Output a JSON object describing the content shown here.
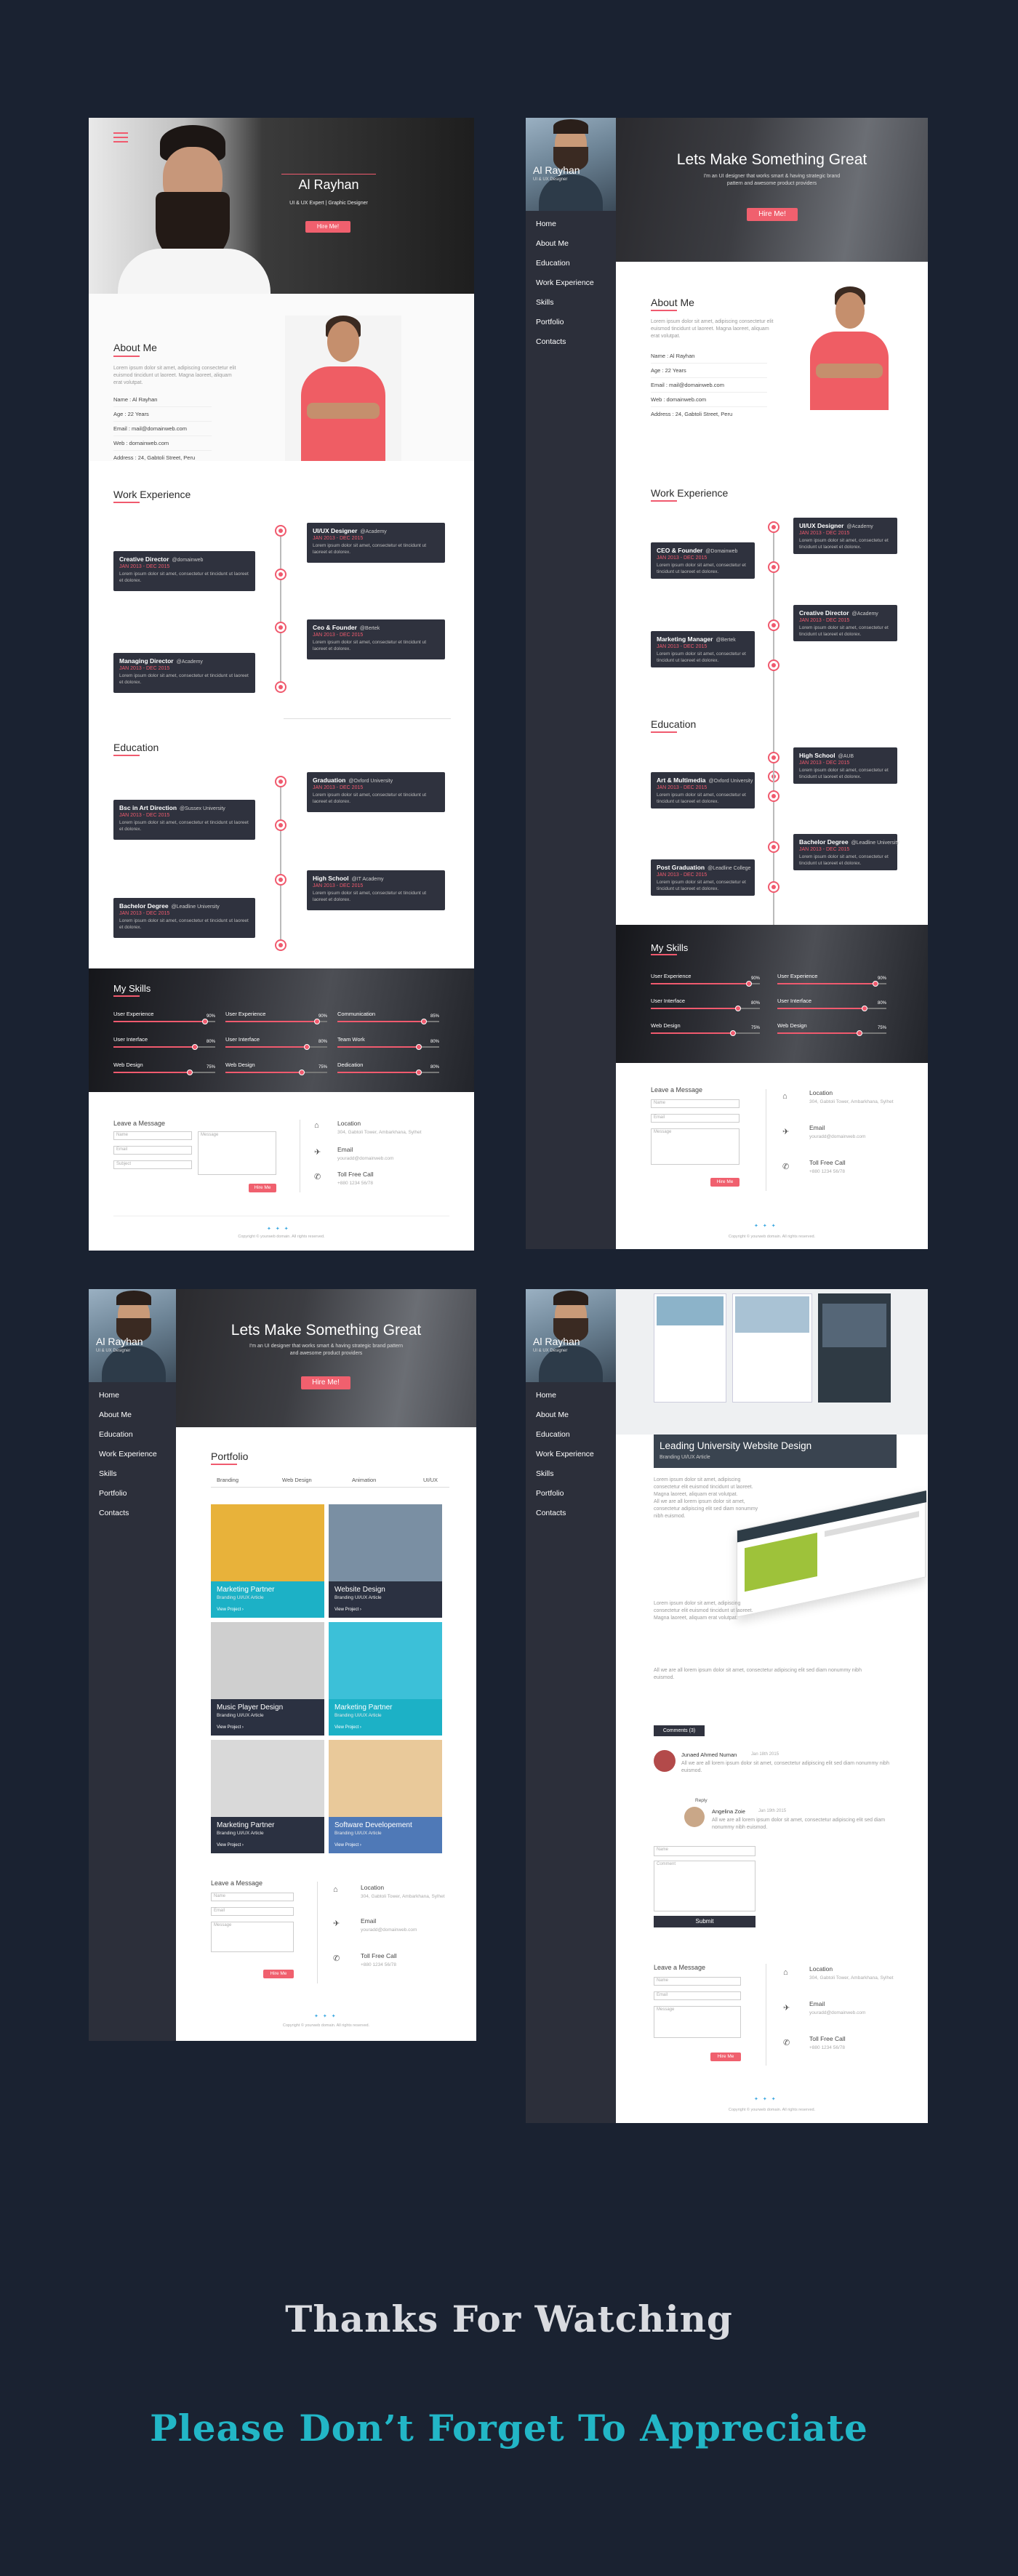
{
  "mock1": {
    "hero_name": "Al Rayhan",
    "hero_role": "UI & UX Expert  |  Graphic Designer",
    "hire_btn": "Hire Me!",
    "about_title": "About Me",
    "about_text": "Lorem ipsum dolor sit amet, adipiscing consectetur elit euismod tincidunt ut laoreet. Magna laoreet, aliquam erat volutpat.",
    "info": [
      "Name : Al Rayhan",
      "Age : 22 Years",
      "Email : mail@domainweb.com",
      "Web : domainweb.com",
      "Address : 24, Gabtoli Street, Peru"
    ],
    "work_title": "Work Experience",
    "edu_title": "Education",
    "skills_title": "My Skills",
    "skills": [
      {
        "name": "User Experience",
        "pct": "90%",
        "value": 0.9
      },
      {
        "name": "User Experience",
        "pct": "90%",
        "value": 0.9
      },
      {
        "name": "Communication",
        "pct": "85%",
        "value": 0.85
      },
      {
        "name": "User Interface",
        "pct": "80%",
        "value": 0.8
      },
      {
        "name": "User Interface",
        "pct": "80%",
        "value": 0.8
      },
      {
        "name": "Team Work",
        "pct": "80%",
        "value": 0.8
      },
      {
        "name": "Web Design",
        "pct": "75%",
        "value": 0.75
      },
      {
        "name": "Web Design",
        "pct": "75%",
        "value": 0.75
      },
      {
        "name": "Dedication",
        "pct": "80%",
        "value": 0.8
      }
    ],
    "leave_title": "Leave a Message",
    "name_ph": "Name",
    "email_ph": "Email",
    "subject_ph": "Subject",
    "message_ph": "Message",
    "send_btn": "Hire Me",
    "location_label": "Location",
    "location_value": "304, Gabtoli Tower, Ambarkhana, Sylhet",
    "email_label": "Email",
    "email_value": "youradd@domainweb.com",
    "call_label": "Toll Free Call",
    "call_value": "+880 1234 56/78",
    "copyright": "Copyright © yourweb domain. All rights reserved."
  },
  "work_items": [
    {
      "title": "UI/UX Designer",
      "org": "@Academy",
      "date": "JAN 2013 - DEC 2015",
      "text": "Lorem ipsum dolor sit amet, consectetur et tincidunt ut laoreet et dolorex."
    },
    {
      "title": "Creative Director",
      "org": "@domainweb",
      "date": "JAN 2013 - DEC 2015",
      "text": "Lorem ipsum dolor sit amet, consectetur et tincidunt ut laoreet et dolorex."
    },
    {
      "title": "Ceo & Founder",
      "org": "@Bertek",
      "date": "JAN 2013 - DEC 2015",
      "text": "Lorem ipsum dolor sit amet, consectetur et tincidunt ut laoreet et dolorex."
    },
    {
      "title": "Managing Director",
      "org": "@Academy",
      "date": "JAN 2013 - DEC 2015",
      "text": "Lorem ipsum dolor sit amet, consectetur et tincidunt ut laoreet et dolorex."
    }
  ],
  "edu_items": [
    {
      "title": "Graduation",
      "org": "@Oxford University",
      "date": "JAN 2013 - DEC 2015",
      "text": "Lorem ipsum dolor sit amet, consectetur et tincidunt ut laoreet et dolorex."
    },
    {
      "title": "Bsc in Art Direction",
      "org": "@Sussex University",
      "date": "JAN 2013 - DEC 2015",
      "text": "Lorem ipsum dolor sit amet, consectetur et tincidunt ut laoreet et dolorex."
    },
    {
      "title": "High School",
      "org": "@IT Academy",
      "date": "JAN 2013 - DEC 2015",
      "text": "Lorem ipsum dolor sit amet, consectetur et tincidunt ut laoreet et dolorex."
    },
    {
      "title": "Bachelor Degree",
      "org": "@Leadline University",
      "date": "JAN 2013 - DEC 2015",
      "text": "Lorem ipsum dolor sit amet, consectetur et tincidunt ut laoreet et dolorex."
    }
  ],
  "mock2": {
    "side_name": "Al Rayhan",
    "side_role": "UI & UX Designer",
    "nav": [
      "Home",
      "About Me",
      "Education",
      "Work Experience",
      "Skills",
      "Portfolio",
      "Contacts"
    ],
    "hero_title": "Lets Make Something Great",
    "hero_sub": "I'm an UI designer that works smart & having strategic brand pattern and awesome product providers",
    "hire_btn": "Hire Me!",
    "about_title": "About Me",
    "work_title": "Work Experience",
    "edu_title": "Education",
    "work": [
      {
        "title": "UI/UX Designer",
        "org": "@Academy"
      },
      {
        "title": "CEO & Founder",
        "org": "@Domainweb"
      },
      {
        "title": "Creative Director",
        "org": "@Academy"
      },
      {
        "title": "Marketing Manager",
        "org": "@Bertek"
      }
    ],
    "edu": [
      {
        "title": "High School",
        "org": "@AUB"
      },
      {
        "title": "Art & Multimedia",
        "org": "@Oxford University"
      },
      {
        "title": "Bachelor Degree",
        "org": "@Leadline University"
      },
      {
        "title": "Post Graduation",
        "org": "@Leadline College"
      }
    ],
    "skills_title": "My Skills",
    "skills": [
      {
        "name": "User Experience",
        "pct": "90%",
        "value": 0.9
      },
      {
        "name": "User Experience",
        "pct": "90%",
        "value": 0.9
      },
      {
        "name": "User Interface",
        "pct": "80%",
        "value": 0.8
      },
      {
        "name": "User Interface",
        "pct": "80%",
        "value": 0.8
      },
      {
        "name": "Web Design",
        "pct": "75%",
        "value": 0.75
      },
      {
        "name": "Web Design",
        "pct": "75%",
        "value": 0.75
      }
    ]
  },
  "mock3": {
    "portfolio_title": "Portfolio",
    "filters": [
      "Branding",
      "Web Design",
      "Animation",
      "UI/UX"
    ],
    "cards": [
      {
        "title": "Marketing Partner",
        "sub": "Branding UI/UX Article",
        "link": "View Project ›",
        "color": "#1cb1c6"
      },
      {
        "title": "Website Design",
        "sub": "Branding UI/UX Article",
        "link": "View Project ›",
        "color": "#2b3141"
      },
      {
        "title": "Music Player Design",
        "sub": "Branding UI/UX Article",
        "link": "View Project ›",
        "color": "#2b3141"
      },
      {
        "title": "Marketing Partner",
        "sub": "Branding UI/UX Article",
        "link": "View Project ›",
        "color": "#1cb1c6"
      },
      {
        "title": "Marketing Partner",
        "sub": "Branding UI/UX Article",
        "link": "View Project ›",
        "color": "#2b3141"
      },
      {
        "title": "Software Developement",
        "sub": "Branding UI/UX Article",
        "link": "View Project ›",
        "color": "#4f79b7"
      }
    ]
  },
  "mock4": {
    "post_title": "Leading University Website Design",
    "post_sub": "Branding UI/UX Article",
    "comments_btn": "Comments (3)",
    "commenter1": "Junaed Ahmed Numan",
    "commenter1_date": "Jan 18th 2015",
    "reply_label": "Reply",
    "commenter2": "Angelina Zoie",
    "commenter2_date": "Jan 19th 2015",
    "comment_text": "All we are all lorem ipsum dolor sit amet, consectetur adipiscing elit sed diam nonummy nibh euismod.",
    "name_ph": "Name",
    "comment_ph": "Comment",
    "submit_btn": "Submit"
  },
  "footer": {
    "thanks": "Thanks For Watching",
    "appreciate": "Please Don’t Forget To Appreciate"
  },
  "colors": {
    "accent": "#f05a6e",
    "bg": "#1a2231",
    "sidebar": "#2c2f3a",
    "teal": "#22b6c6"
  }
}
